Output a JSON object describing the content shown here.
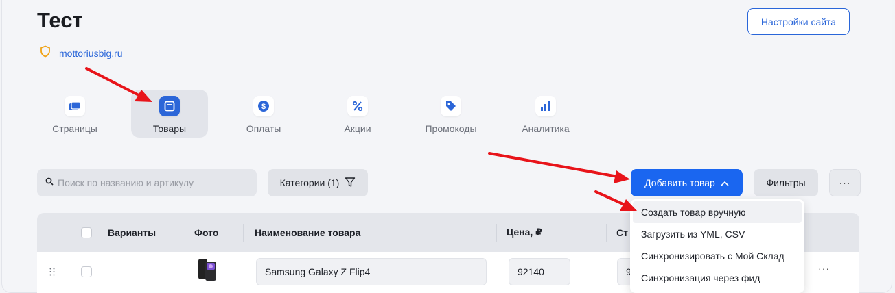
{
  "page": {
    "title": "Тест",
    "site_domain": "mottoriusbig.ru",
    "settings_button": "Настройки сайта"
  },
  "nav": {
    "items": [
      {
        "label": "Страницы",
        "icon": "pages-icon",
        "active": false
      },
      {
        "label": "Товары",
        "icon": "products-icon",
        "active": true
      },
      {
        "label": "Оплаты",
        "icon": "payments-icon",
        "active": false
      },
      {
        "label": "Акции",
        "icon": "percent-icon",
        "active": false
      },
      {
        "label": "Промокоды",
        "icon": "tag-icon",
        "active": false
      },
      {
        "label": "Аналитика",
        "icon": "chart-icon",
        "active": false
      }
    ]
  },
  "toolbar": {
    "search_placeholder": "Поиск по названию и артикулу",
    "categories_button": "Категории (1)",
    "add_button": "Добавить товар",
    "filters_button": "Фильтры",
    "more_button": "···"
  },
  "dropdown": {
    "items": [
      "Создать товар вручную",
      "Загрузить из YML, CSV",
      "Синхронизировать с Мой Склад",
      "Синхронизация через фид"
    ]
  },
  "table": {
    "columns": [
      "Варианты",
      "Фото",
      "Наименование товара",
      "Цена, ₽",
      "Ст"
    ],
    "rows": [
      {
        "name": "Samsung Galaxy Z Flip4",
        "price": "92140",
        "stock_partial": "9",
        "more": "···"
      }
    ]
  },
  "colors": {
    "accent": "#1a66f0",
    "link": "#2a66d9",
    "arrow": "#e8141a",
    "shield": "#f0a419"
  }
}
